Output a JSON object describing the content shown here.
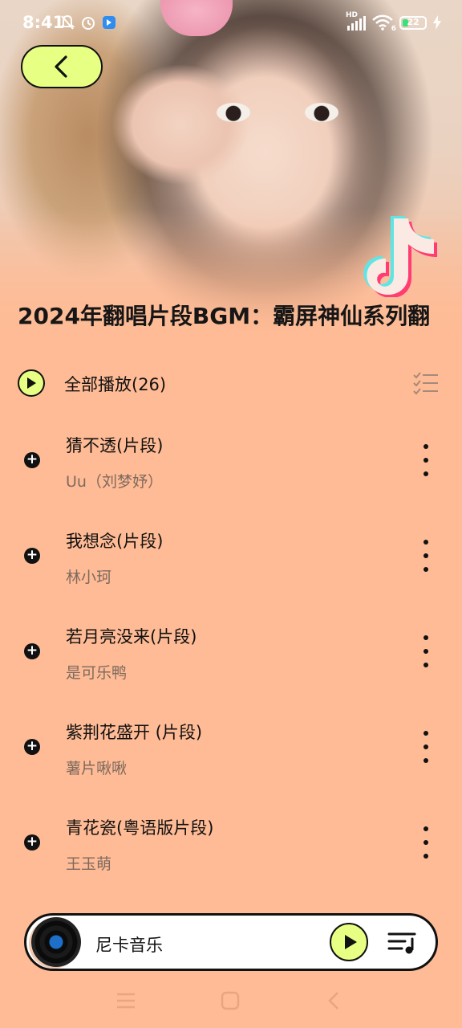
{
  "status_bar": {
    "time": "8:41",
    "icons_left": [
      "notifications-off-icon",
      "alarm-icon",
      "app-badge-icon"
    ],
    "network": "HD",
    "wifi_label": "6",
    "battery_level": "22"
  },
  "header": {
    "back_icon": "chevron-left-icon",
    "playlist_title": "2024年翻唱片段BGM：霸屏神仙系列翻"
  },
  "play_all": {
    "label": "全部播放(26)"
  },
  "songs": [
    {
      "title": "猜不透(片段)",
      "artist": "Uu（刘梦妤）"
    },
    {
      "title": "我想念(片段)",
      "artist": "林小珂"
    },
    {
      "title": "若月亮没来(片段)",
      "artist": "是可乐鸭"
    },
    {
      "title": "紫荆花盛开 (片段)",
      "artist": "薯片啾啾"
    },
    {
      "title": "青花瓷(粤语版片段)",
      "artist": "王玉萌"
    }
  ],
  "mini_player": {
    "title": "尼卡音乐"
  },
  "colors": {
    "background": "#ffbb95",
    "accent": "#e7ff83",
    "text_primary": "#111111",
    "text_secondary": "#7d6a5e"
  }
}
